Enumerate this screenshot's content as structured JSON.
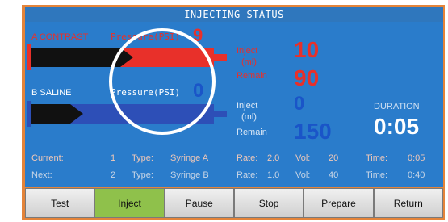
{
  "title": "INJECTING STATUS",
  "channel_a": {
    "label": "A CONTRAST",
    "pressure_label": "Pressure(PSI)",
    "pressure_value": "9",
    "inject_label": "Inject",
    "ml_label": "(ml)",
    "inject_value": "10",
    "remain_label": "Remain",
    "remain_value": "90"
  },
  "channel_b": {
    "label": "B SALINE",
    "pressure_label": "Pressure(PSI)",
    "pressure_value": "0",
    "inject_label": "Inject",
    "ml_label": "(ml)",
    "inject_value": "0",
    "remain_label": "Remain",
    "remain_value": "150"
  },
  "duration": {
    "label": "DURATION",
    "value": "0:05"
  },
  "current": {
    "label": "Current:",
    "index": "1",
    "type_label": "Type:",
    "type_value": "Syringe A",
    "rate_label": "Rate:",
    "rate_value": "2.0",
    "vol_label": "Vol:",
    "vol_value": "20",
    "time_label": "Time:",
    "time_value": "0:05"
  },
  "next": {
    "label": "Next:",
    "index": "2",
    "type_label": "Type:",
    "type_value": "Syringe B",
    "rate_label": "Rate:",
    "rate_value": "1.0",
    "vol_label": "Vol:",
    "vol_value": "40",
    "time_label": "Time:",
    "time_value": "0:40"
  },
  "buttons": {
    "test": "Test",
    "inject": "Inject",
    "pause": "Pause",
    "stop": "Stop",
    "prepare": "Prepare",
    "return": "Return"
  },
  "colors": {
    "panel": "#2a7ccb",
    "frame": "#e4843a",
    "contrast": "#e8302a",
    "saline": "#2d4fb7",
    "active_button": "#8fc14b"
  }
}
